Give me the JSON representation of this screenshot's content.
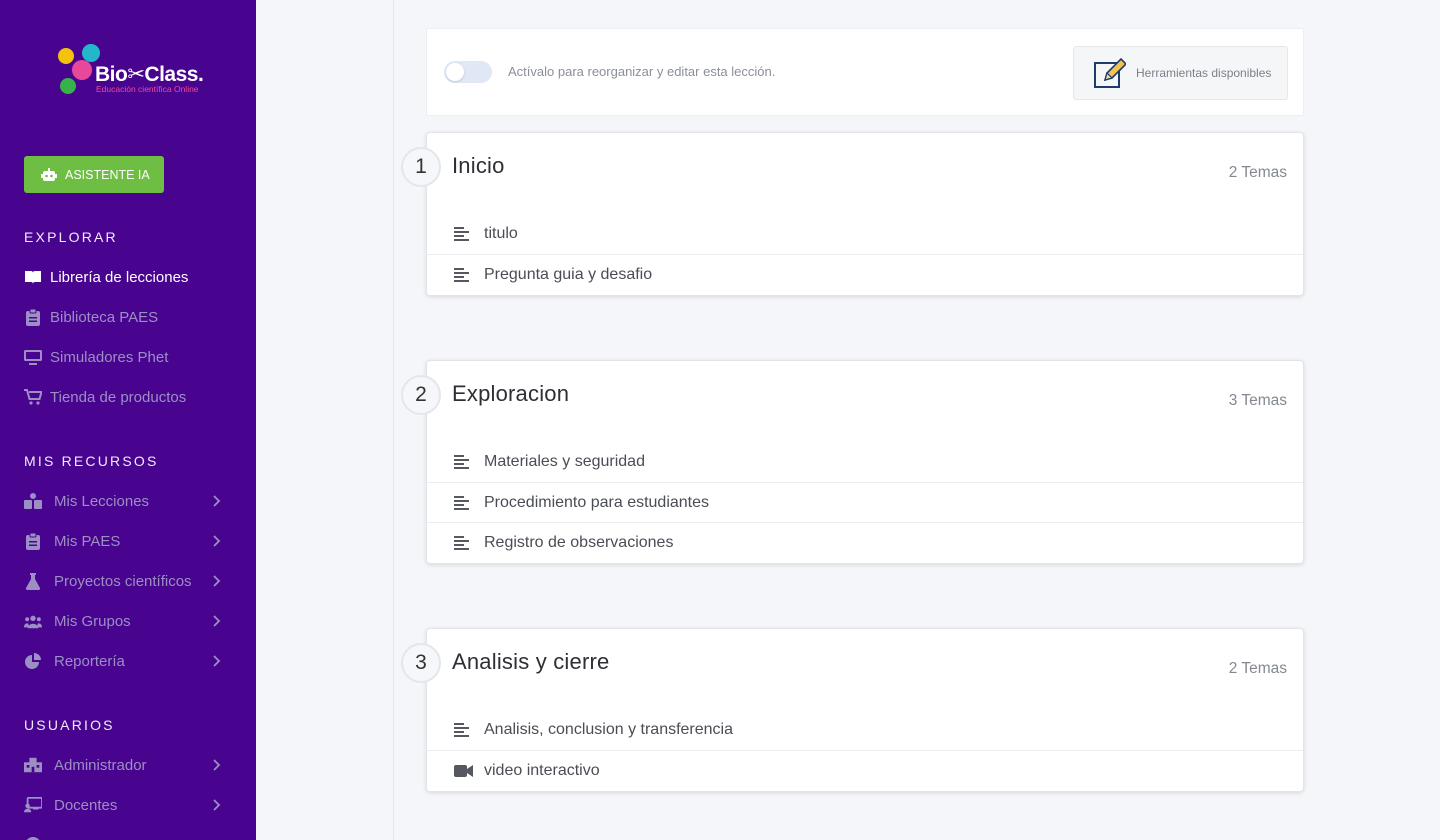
{
  "brand": {
    "name": "Bio✂Class.",
    "tagline": "Educación científica Online"
  },
  "colors": {
    "sidebar_bg": "#48048f",
    "ai_button": "#6fbe44",
    "active_nav": "#ffffff",
    "muted_nav": "#9b8fc4"
  },
  "sidebar": {
    "ai_button_label": "ASISTENTE IA",
    "explore": {
      "title": "EXPLORAR",
      "items": [
        {
          "label": "Librería de lecciones",
          "icon": "book-open-icon",
          "active": true
        },
        {
          "label": "Biblioteca PAES",
          "icon": "clipboard-icon"
        },
        {
          "label": "Simuladores Phet",
          "icon": "monitor-icon"
        },
        {
          "label": "Tienda de productos",
          "icon": "cart-icon"
        }
      ]
    },
    "resources": {
      "title": "MIS RECURSOS",
      "items": [
        {
          "label": "Mis Lecciones",
          "icon": "lessons-icon"
        },
        {
          "label": "Mis PAES",
          "icon": "clipboard-icon"
        },
        {
          "label": "Proyectos científicos",
          "icon": "flask-icon"
        },
        {
          "label": "Mis Grupos",
          "icon": "users-icon"
        },
        {
          "label": "Reportería",
          "icon": "pie-chart-icon"
        }
      ]
    },
    "users": {
      "title": "USUARIOS",
      "items": [
        {
          "label": "Administrador",
          "icon": "building-icon"
        },
        {
          "label": "Docentes",
          "icon": "teacher-icon"
        }
      ]
    }
  },
  "toolbar": {
    "toggle_label": "Actívalo para reorganizar y editar esta lección.",
    "toggle_on": false,
    "tools_label": "Herramientas disponibles"
  },
  "sections": [
    {
      "number": "1",
      "title": "Inicio",
      "count": "2 Temas",
      "topics": [
        {
          "label": "titulo",
          "icon": "text-lines-icon"
        },
        {
          "label": "Pregunta guia y desafio",
          "icon": "text-lines-icon"
        }
      ]
    },
    {
      "number": "2",
      "title": "Exploracion",
      "count": "3 Temas",
      "topics": [
        {
          "label": "Materiales y seguridad",
          "icon": "text-lines-icon"
        },
        {
          "label": "Procedimiento para estudiantes",
          "icon": "text-lines-icon"
        },
        {
          "label": "Registro de observaciones",
          "icon": "text-lines-icon"
        }
      ]
    },
    {
      "number": "3",
      "title": "Analisis y cierre",
      "count": "2 Temas",
      "topics": [
        {
          "label": "Analisis, conclusion y transferencia",
          "icon": "text-lines-icon"
        },
        {
          "label": "video interactivo",
          "icon": "video-camera-icon"
        }
      ]
    }
  ]
}
